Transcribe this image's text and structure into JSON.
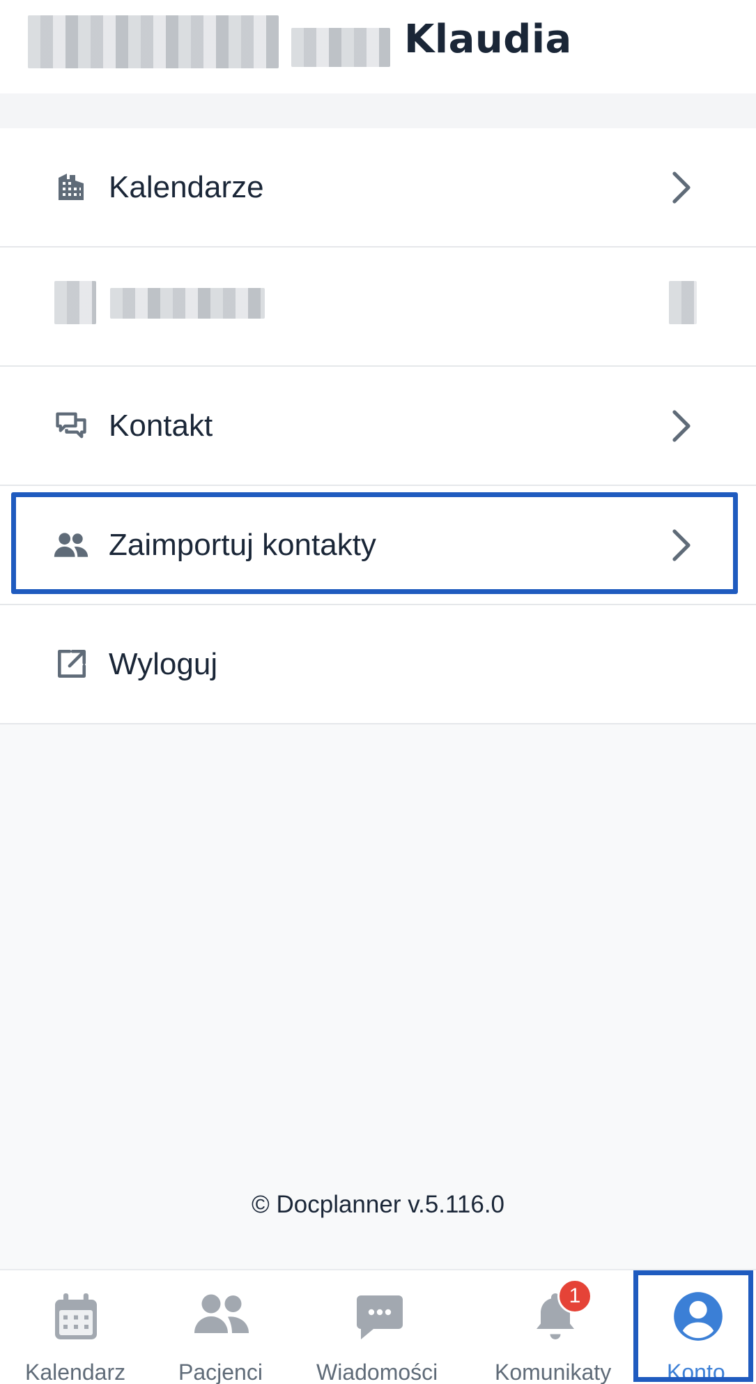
{
  "header": {
    "name": "Klaudia"
  },
  "menu": {
    "items": [
      {
        "label": "Kalendarze",
        "icon": "building-icon"
      },
      {
        "label": "",
        "icon": "redacted"
      },
      {
        "label": "Kontakt",
        "icon": "chat-bubbles-icon"
      },
      {
        "label": "Zaimportuj kontakty",
        "icon": "people-icon"
      },
      {
        "label": "Wyloguj",
        "icon": "external-link-icon"
      }
    ]
  },
  "footer": {
    "version": "© Docplanner v.5.116.0"
  },
  "bottom_nav": {
    "items": [
      {
        "label": "Kalendarz",
        "icon": "calendar-icon"
      },
      {
        "label": "Pacjenci",
        "icon": "patients-icon"
      },
      {
        "label": "Wiadomości",
        "icon": "message-icon"
      },
      {
        "label": "Komunikaty",
        "icon": "bell-icon",
        "badge": "1"
      },
      {
        "label": "Konto",
        "icon": "account-icon",
        "active": true
      }
    ]
  },
  "colors": {
    "accent": "#3b7fd6",
    "highlight": "#1f5bbf",
    "badge": "#e54337",
    "icon": "#5f6b78"
  }
}
